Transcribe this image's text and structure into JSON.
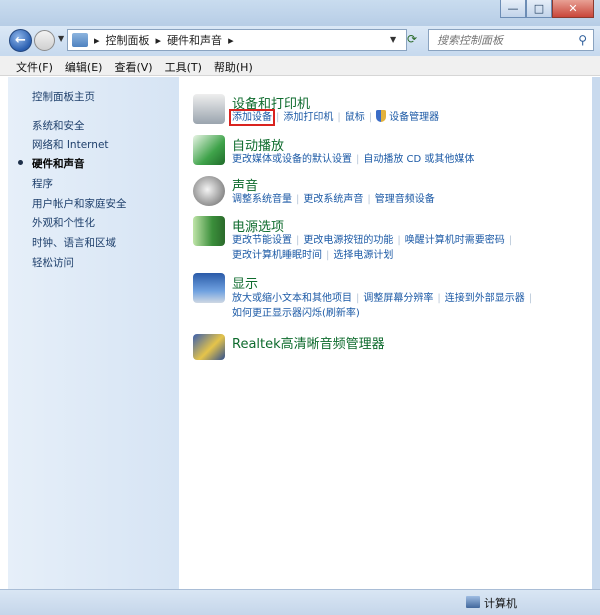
{
  "nav": {
    "breadcrumb": [
      "控制面板",
      "硬件和声音"
    ],
    "search_placeholder": "搜索控制面板"
  },
  "menubar": [
    "文件(F)",
    "编辑(E)",
    "查看(V)",
    "工具(T)",
    "帮助(H)"
  ],
  "sidebar": {
    "home": "控制面板主页",
    "items": [
      "系统和安全",
      "网络和 Internet",
      "硬件和声音",
      "程序",
      "用户帐户和家庭安全",
      "外观和个性化",
      "时钟、语言和区域",
      "轻松访问"
    ],
    "active_index": 2
  },
  "sections": [
    {
      "title": "设备和打印机",
      "icon": "printer-icon",
      "links": [
        "添加设备",
        "添加打印机",
        "鼠标",
        "设备管理器"
      ]
    },
    {
      "title": "自动播放",
      "icon": "autoplay-icon",
      "links": [
        "更改媒体或设备的默认设置",
        "自动播放 CD 或其他媒体"
      ]
    },
    {
      "title": "声音",
      "icon": "speaker-icon",
      "links": [
        "调整系统音量",
        "更改系统声音",
        "管理音频设备"
      ]
    },
    {
      "title": "电源选项",
      "icon": "battery-icon",
      "links": [
        "更改节能设置",
        "更改电源按钮的功能",
        "唤醒计算机时需要密码",
        "更改计算机睡眠时间",
        "选择电源计划"
      ]
    },
    {
      "title": "显示",
      "icon": "monitor-icon",
      "links": [
        "放大或缩小文本和其他项目",
        "调整屏幕分辨率",
        "连接到外部显示器",
        "如何更正显示器闪烁(刷新率)"
      ]
    },
    {
      "title": "Realtek高清晰音频管理器",
      "icon": "realtek-icon",
      "links": []
    }
  ],
  "status": {
    "computer": "计算机"
  },
  "colors": {
    "accent_link": "#1c5aa6",
    "section_title": "#0e6b2d",
    "highlight_box": "#d9231f"
  }
}
